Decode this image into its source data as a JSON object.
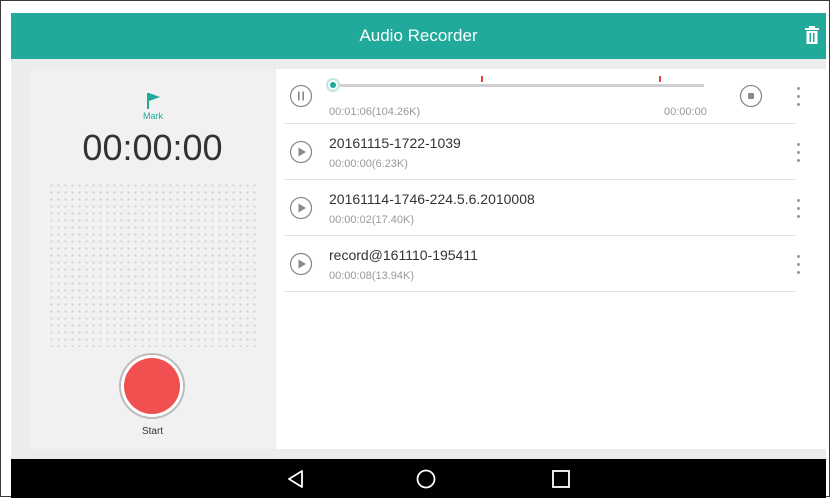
{
  "app": {
    "title": "Audio Recorder"
  },
  "recorder": {
    "mark_label": "Mark",
    "timer": "00:00:00",
    "start_label": "Start"
  },
  "current": {
    "elapsed": "00:01:06(104.26K)",
    "remaining": "00:00:00",
    "progress": 0.0
  },
  "recordings": [
    {
      "name": "20161115-1722-1039",
      "info": "00:00:00(6.23K)"
    },
    {
      "name": "20161114-1746-224.5.6.2010008",
      "info": "00:00:02(17.40K)"
    },
    {
      "name": "record@161110-195411",
      "info": "00:00:08(13.94K)"
    }
  ],
  "icons": {
    "trash": "trash-icon",
    "flag": "flag-icon",
    "pause": "pause-icon",
    "play": "play-icon",
    "stop": "stop-icon",
    "more": "more-vert-icon",
    "back": "back-icon",
    "home": "home-icon",
    "recents": "recents-icon"
  },
  "colors": {
    "accent": "#21aa9a",
    "record": "#f15050",
    "marker": "#e84040"
  }
}
